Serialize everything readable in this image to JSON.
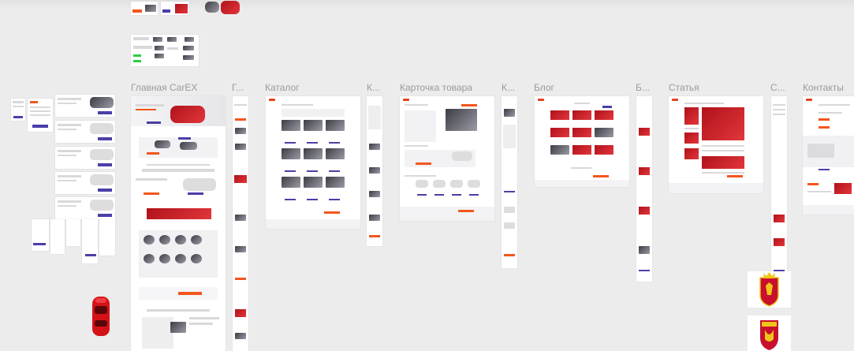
{
  "boards": [
    {
      "label": "Главная CarEX",
      "short": "Главная CarEX"
    },
    {
      "label": "Г...",
      "short": "Г..."
    },
    {
      "label": "Каталог",
      "short": "Каталог"
    },
    {
      "label": "К...",
      "short": "К..."
    },
    {
      "label": "Карточка товара",
      "short": "Карточка товара"
    },
    {
      "label": "К...",
      "short": "К..."
    },
    {
      "label": "Блог",
      "short": "Блог"
    },
    {
      "label": "Б...",
      "short": "Б..."
    },
    {
      "label": "Статья",
      "short": "Статья"
    },
    {
      "label": "С...",
      "short": "С..."
    },
    {
      "label": "Контакты",
      "short": "Контакты"
    }
  ],
  "colors": {
    "accent_orange": "#f2561d",
    "accent_purple": "#4b3fa8",
    "canvas": "#ececec",
    "crest_red": "#c8102e"
  },
  "icons": [
    "red-car-icon",
    "coat-of-arms-icon",
    "city-crest-icon"
  ]
}
